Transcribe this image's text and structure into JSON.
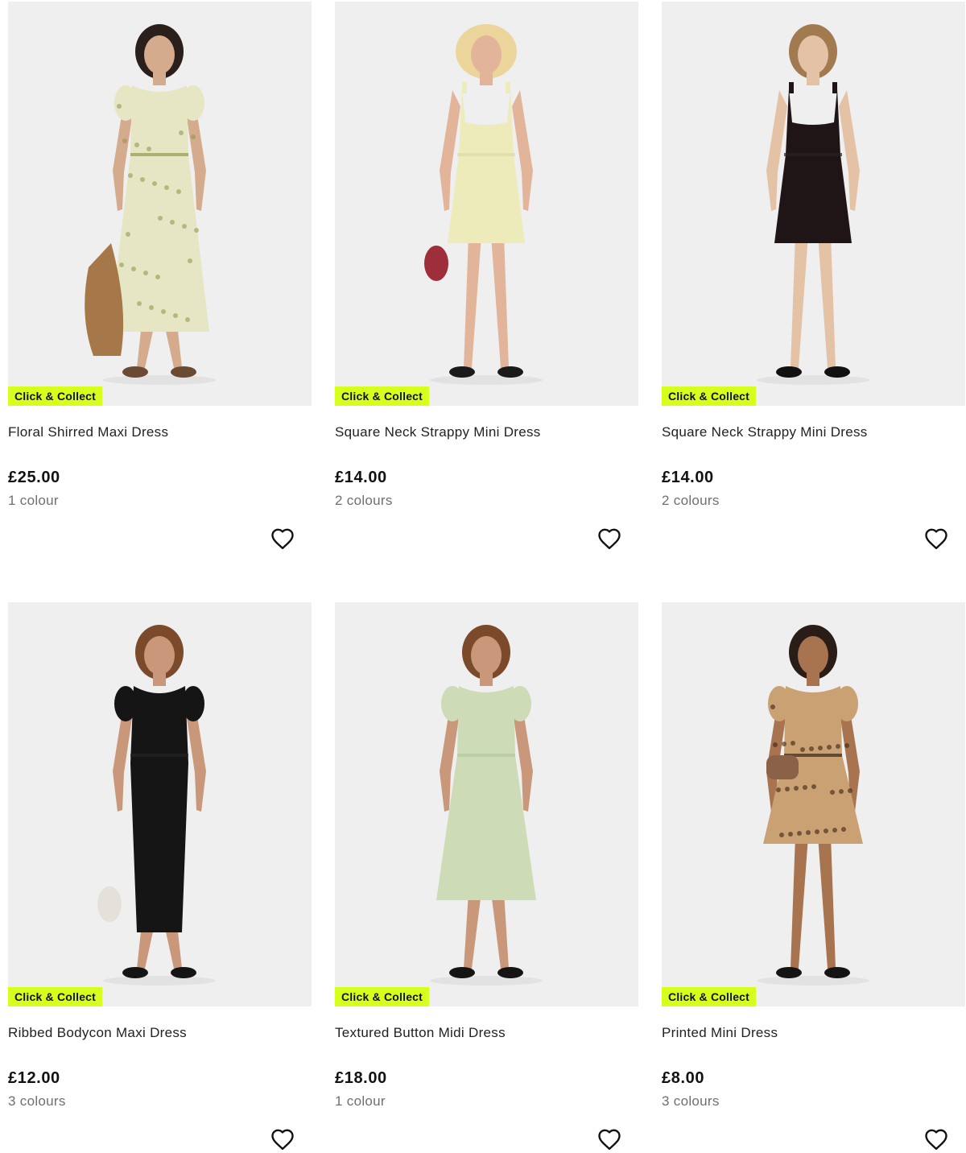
{
  "badge_color": "#d7ff1e",
  "image_background": "#efefef",
  "wishlist_icon": "heart-outline-icon",
  "products": [
    {
      "name": "Floral Shirred Maxi Dress",
      "price": "£25.00",
      "colours": "1 colour",
      "badge": "Click & Collect",
      "skin": "#d4ab8c",
      "hair": "#2a1f1a",
      "dress": "#e7e6c4",
      "dress_accent": "#8f9b4f",
      "bag": "#a67849",
      "shoe": "#6b4a34",
      "dress_shape": "maxi-puff"
    },
    {
      "name": "Square Neck Strappy Mini Dress",
      "price": "£14.00",
      "colours": "2 colours",
      "badge": "Click & Collect",
      "skin": "#e2b59a",
      "hair": "#ecd59b",
      "dress": "#ecebb9",
      "dress_accent": "#dcdba6",
      "bag": "#9e2f3a",
      "shoe": "#1a1a1a",
      "dress_shape": "mini-strap"
    },
    {
      "name": "Square Neck Strappy Mini Dress",
      "price": "£14.00",
      "colours": "2 colours",
      "badge": "Click & Collect",
      "skin": "#e3c2a6",
      "hair": "#a27a4f",
      "dress": "#1f1516",
      "dress_accent": "#2c2021",
      "bag": "",
      "shoe": "#111111",
      "dress_shape": "mini-strap"
    },
    {
      "name": "Ribbed Bodycon Maxi Dress",
      "price": "£12.00",
      "colours": "3 colours",
      "badge": "Click & Collect",
      "skin": "#c9977a",
      "hair": "#7a4a2a",
      "dress": "#151515",
      "dress_accent": "#242424",
      "bag": "#e4e0da",
      "shoe": "#141414",
      "dress_shape": "maxi-bodycon"
    },
    {
      "name": "Textured Button Midi Dress",
      "price": "£18.00",
      "colours": "1 colour",
      "badge": "Click & Collect",
      "skin": "#c9977a",
      "hair": "#7a4a2a",
      "dress": "#cddcb7",
      "dress_accent": "#b5c79a",
      "bag": "",
      "shoe": "#141414",
      "dress_shape": "midi-puff"
    },
    {
      "name": "Printed Mini Dress",
      "price": "£8.00",
      "colours": "3 colours",
      "badge": "Click & Collect",
      "skin": "#a8734f",
      "hair": "#2a1c16",
      "dress": "#c9a172",
      "dress_accent": "#3a2414",
      "bag": "#8a6247",
      "shoe": "#141414",
      "dress_shape": "mini-puff"
    }
  ]
}
